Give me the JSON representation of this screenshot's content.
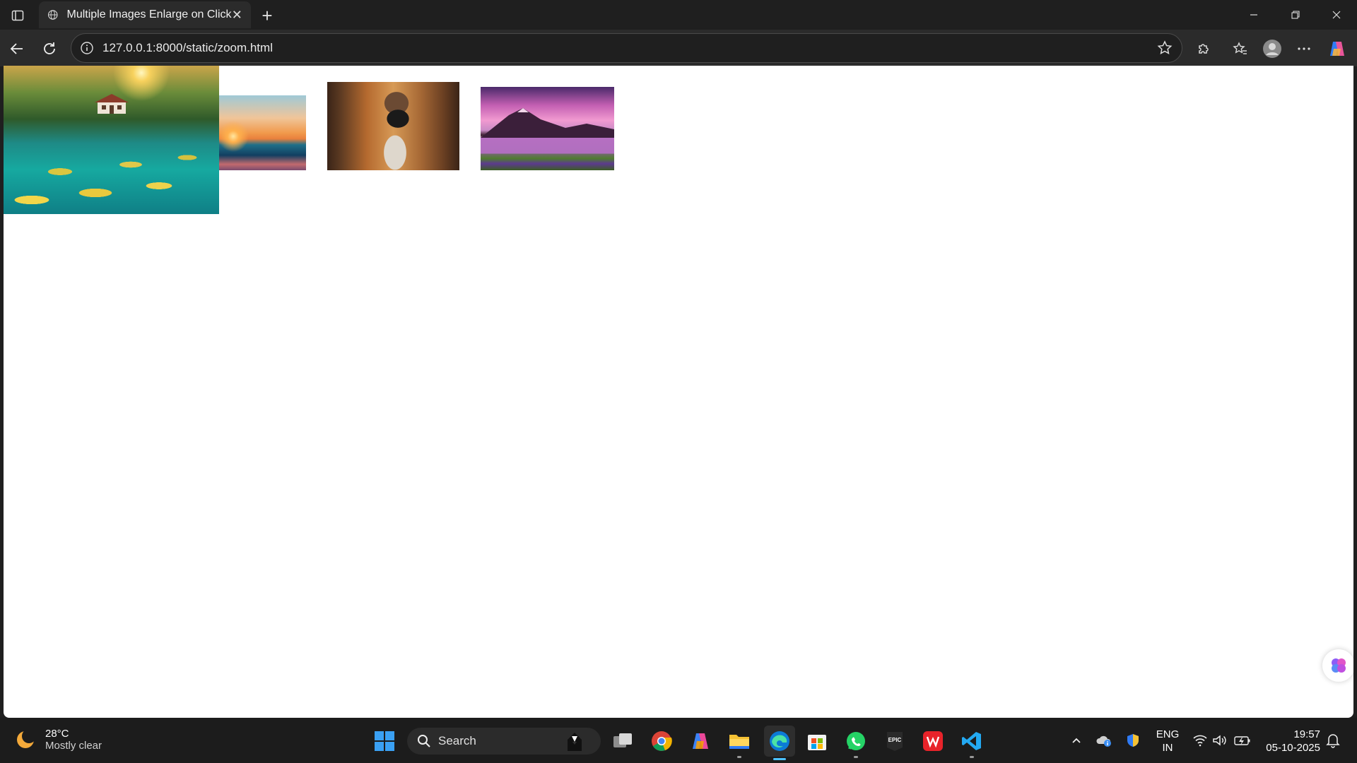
{
  "browser": {
    "tab": {
      "title": "Multiple Images Enlarge on Click",
      "close_glyph": "✕"
    },
    "new_tab_glyph": "+",
    "url": "127.0.0.1:8000/static/zoom.html",
    "window_controls": {
      "minimize": "—",
      "maximize": "❐",
      "close": "✕"
    }
  },
  "page": {
    "images": [
      {
        "name": "lake-house-lily-pads",
        "state": "enlarged"
      },
      {
        "name": "sunset-beach",
        "state": "normal"
      },
      {
        "name": "person-with-camera-forest",
        "state": "normal"
      },
      {
        "name": "mountain-lake-purple-flowers",
        "state": "normal"
      }
    ]
  },
  "taskbar": {
    "weather": {
      "temp": "28°C",
      "desc": "Mostly clear"
    },
    "search": {
      "label": "Search"
    },
    "language": {
      "line1": "ENG",
      "line2": "IN"
    },
    "clock": {
      "time": "19:57",
      "date": "05-10-2025"
    }
  },
  "colors": {
    "accent": "#4cc2ff",
    "titlebar": "#1f1f1f",
    "toolbar": "#2b2b2b"
  }
}
